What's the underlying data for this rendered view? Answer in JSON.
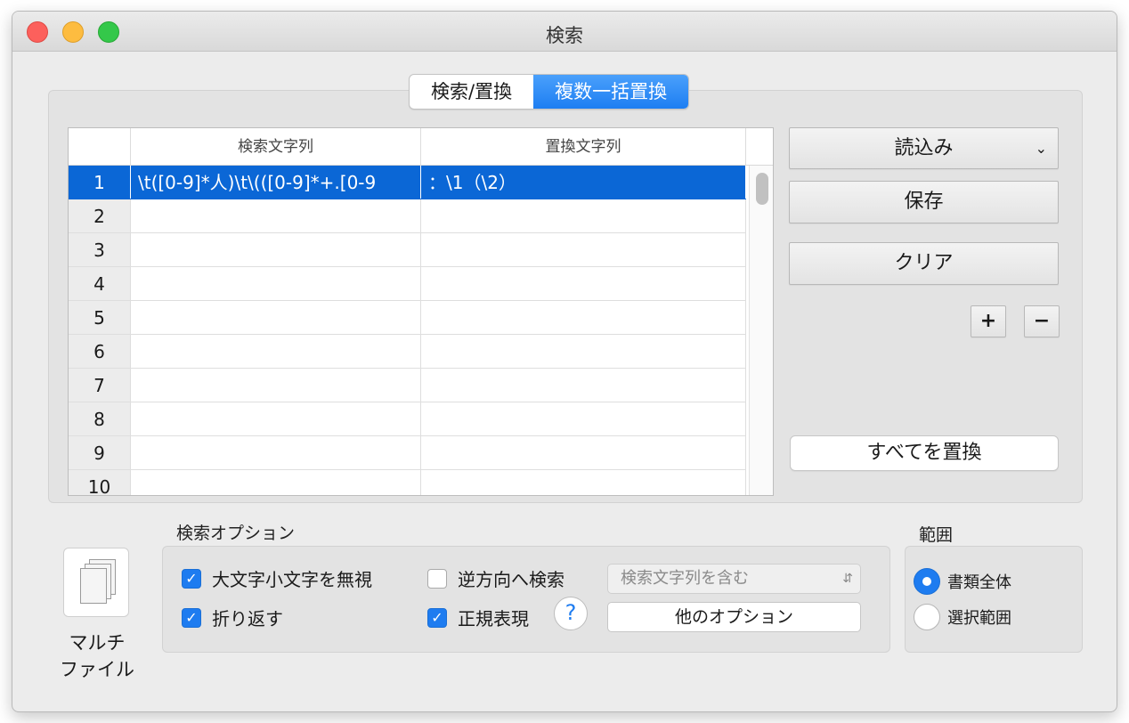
{
  "window": {
    "title": "検索"
  },
  "tabs": [
    {
      "label": "検索/置換",
      "active": false
    },
    {
      "label": "複数一括置換",
      "active": true
    }
  ],
  "table": {
    "columns": [
      "",
      "検索文字列",
      "置換文字列"
    ],
    "rows": [
      {
        "num": "1",
        "search": "\\t([0-9]*人)\\t\\(([0-9]*+.[0-9",
        "replace": "：\\1（\\2）",
        "selected": true
      },
      {
        "num": "2",
        "search": "",
        "replace": ""
      },
      {
        "num": "3",
        "search": "",
        "replace": ""
      },
      {
        "num": "4",
        "search": "",
        "replace": ""
      },
      {
        "num": "5",
        "search": "",
        "replace": ""
      },
      {
        "num": "6",
        "search": "",
        "replace": ""
      },
      {
        "num": "7",
        "search": "",
        "replace": ""
      },
      {
        "num": "8",
        "search": "",
        "replace": ""
      },
      {
        "num": "9",
        "search": "",
        "replace": ""
      },
      {
        "num": "10",
        "search": "",
        "replace": ""
      }
    ]
  },
  "buttons": {
    "load": "読込み",
    "save": "保存",
    "clear": "クリア",
    "add": "+",
    "remove": "−",
    "replace_all": "すべてを置換",
    "help": "?",
    "other_options": "他のオプション"
  },
  "options": {
    "title": "検索オプション",
    "ignore_case": {
      "label": "大文字小文字を無視",
      "checked": true
    },
    "wrap": {
      "label": "折り返す",
      "checked": true
    },
    "reverse": {
      "label": "逆方向へ検索",
      "checked": false
    },
    "regex": {
      "label": "正規表現",
      "checked": true
    },
    "match_select": "検索文字列を含む"
  },
  "range": {
    "title": "範囲",
    "whole": {
      "label": "書類全体",
      "selected": true
    },
    "selection": {
      "label": "選択範囲",
      "selected": false
    }
  },
  "multi_file": {
    "label_line1": "マルチ",
    "label_line2": "ファイル"
  },
  "colors": {
    "accent": "#1e7cf0",
    "selection": "#0b67d6"
  },
  "icons": {
    "popup": "chevron-down-icon",
    "select": "updown-arrows-icon",
    "check": "checkmark-icon",
    "multi": "documents-icon"
  }
}
